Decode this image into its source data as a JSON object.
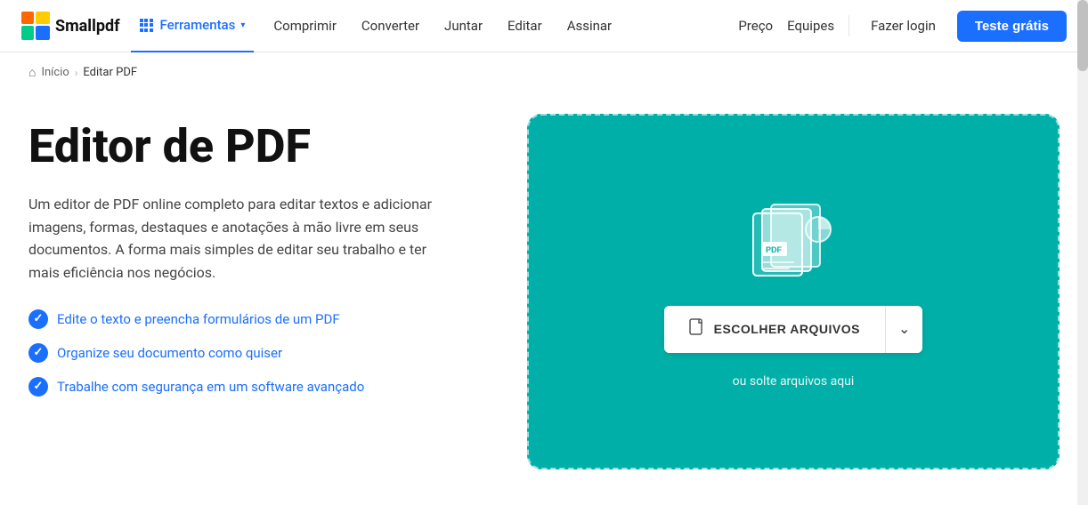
{
  "brand": {
    "name": "Smallpdf"
  },
  "navbar": {
    "ferramentas_label": "Ferramentas",
    "links": [
      {
        "label": "Comprimir"
      },
      {
        "label": "Converter"
      },
      {
        "label": "Juntar"
      },
      {
        "label": "Editar"
      },
      {
        "label": "Assinar"
      }
    ],
    "preco_label": "Preço",
    "equipes_label": "Equipes",
    "login_label": "Fazer login",
    "trial_label": "Teste grátis"
  },
  "breadcrumb": {
    "home_label": "Início",
    "separator": "›",
    "current_label": "Editar PDF"
  },
  "hero": {
    "title": "Editor de PDF",
    "description": "Um editor de PDF online completo para editar textos e adicionar imagens, formas, destaques e anotações à mão livre em seus documentos. A forma mais simples de editar seu trabalho e ter mais eficiência nos negócios.",
    "features": [
      "Edite o texto e preencha formulários de um PDF",
      "Organize seu documento como quiser",
      "Trabalhe com segurança em um software avançado"
    ]
  },
  "upload": {
    "choose_files_label": "ESCOLHER ARQUIVOS",
    "drop_text": "ou solte arquivos aqui"
  }
}
